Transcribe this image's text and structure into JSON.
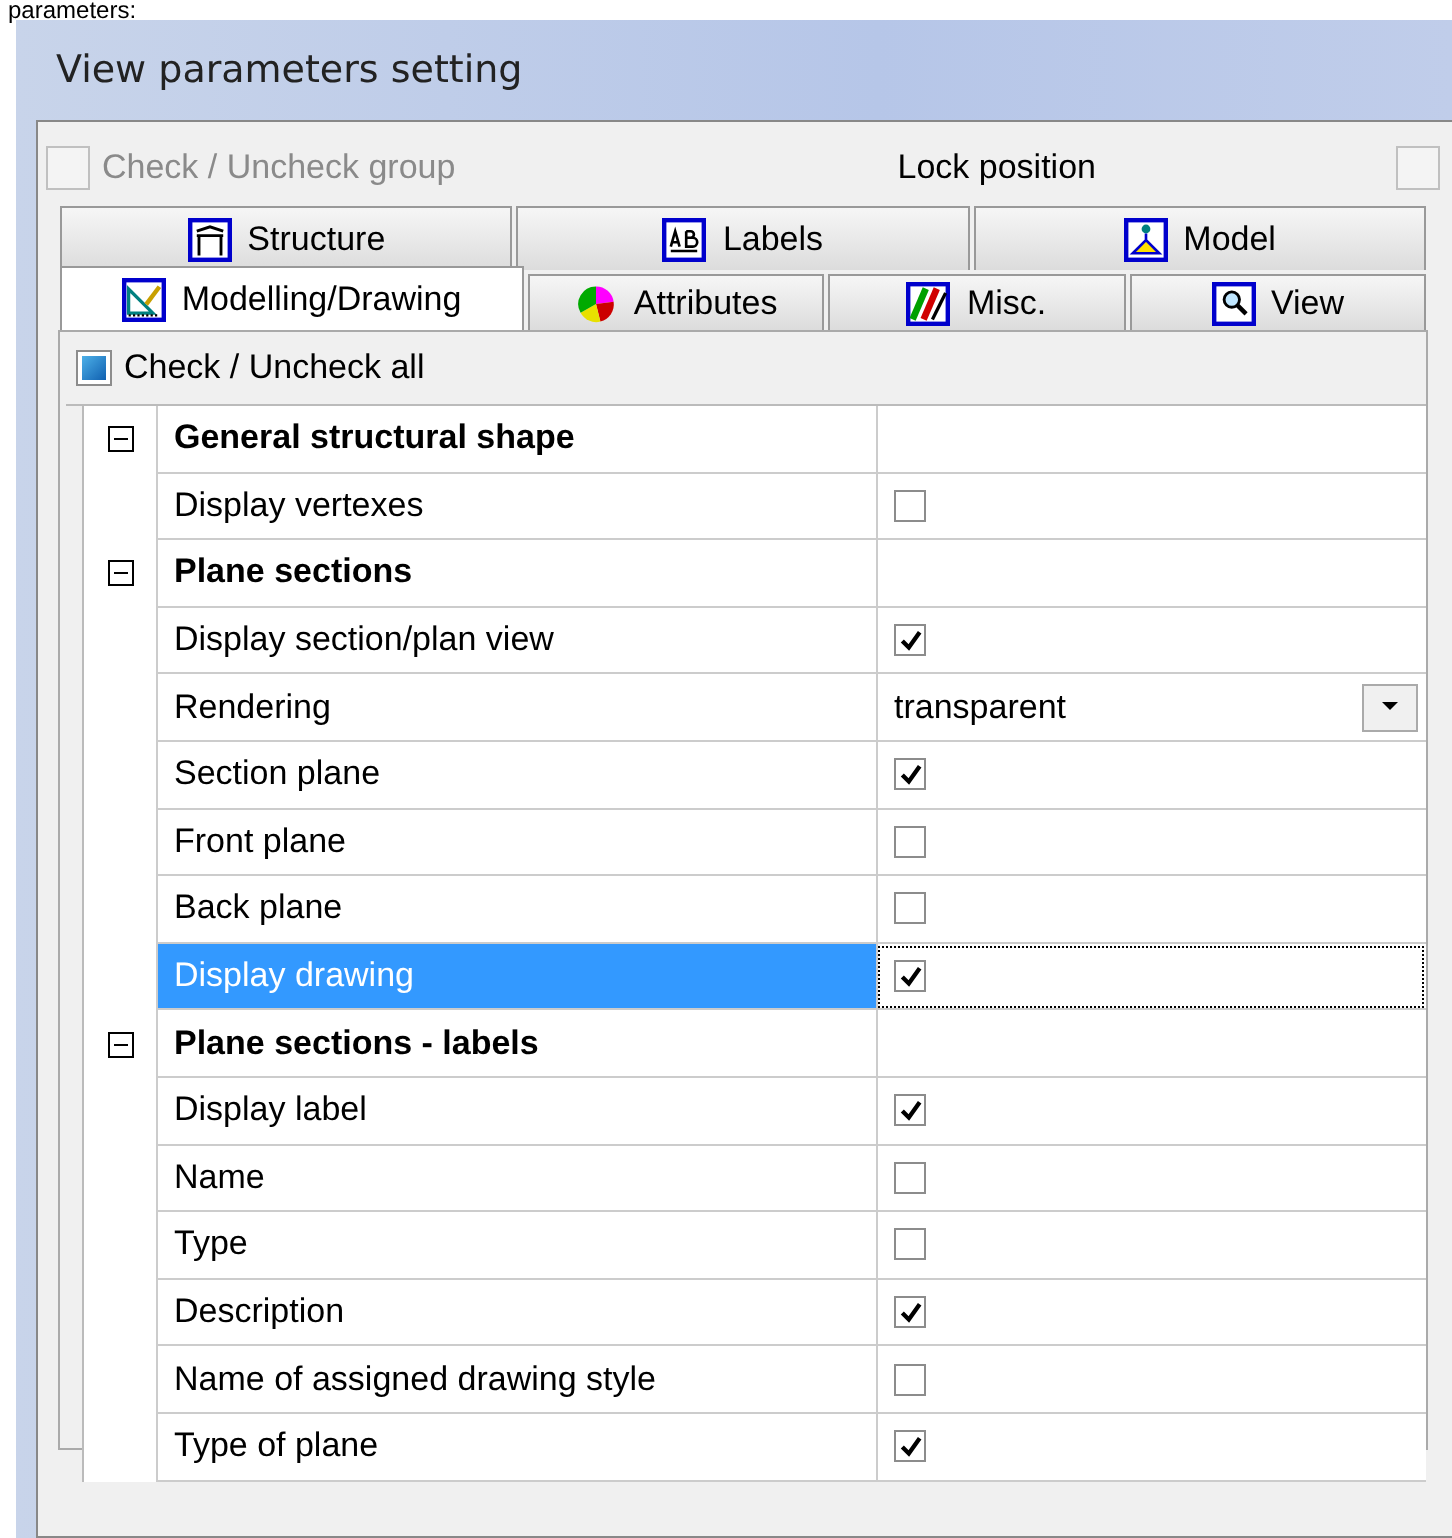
{
  "caption": "parameters:",
  "window": {
    "title": "View parameters setting"
  },
  "check_group": {
    "label": "Check / Uncheck group",
    "checked": false,
    "disabled": true
  },
  "lock_position": {
    "label": "Lock position",
    "checked": false
  },
  "tab_rows": [
    {
      "tabs": [
        {
          "label": "Structure",
          "selected": false
        },
        {
          "label": "Labels",
          "selected": false
        },
        {
          "label": "Model",
          "selected": false
        }
      ]
    },
    {
      "tabs": [
        {
          "label": "Modelling/Drawing",
          "selected": true
        },
        {
          "label": "Attributes",
          "selected": false
        },
        {
          "label": "Misc.",
          "selected": false
        },
        {
          "label": "View",
          "selected": false
        }
      ]
    }
  ],
  "check_all": {
    "label": "Check / Uncheck all",
    "indeterminate": true
  },
  "groups": [
    {
      "title": "General structural shape",
      "expanded": true,
      "rows": [
        {
          "label": "Display vertexes",
          "kind": "checkbox",
          "checked": false,
          "selected": false
        }
      ]
    },
    {
      "title": "Plane sections",
      "expanded": true,
      "rows": [
        {
          "label": "Display section/plan view",
          "kind": "checkbox",
          "checked": true,
          "selected": false
        },
        {
          "label": "Rendering",
          "kind": "dropdown",
          "value": "transparent",
          "selected": false
        },
        {
          "label": "Section plane",
          "kind": "checkbox",
          "checked": true,
          "selected": false
        },
        {
          "label": "Front plane",
          "kind": "checkbox",
          "checked": false,
          "selected": false
        },
        {
          "label": "Back plane",
          "kind": "checkbox",
          "checked": false,
          "selected": false
        },
        {
          "label": "Display drawing",
          "kind": "checkbox",
          "checked": true,
          "selected": true
        }
      ]
    },
    {
      "title": "Plane sections - labels",
      "expanded": true,
      "rows": [
        {
          "label": "Display label",
          "kind": "checkbox",
          "checked": true,
          "selected": false
        },
        {
          "label": "Name",
          "kind": "checkbox",
          "checked": false,
          "selected": false
        },
        {
          "label": "Type",
          "kind": "checkbox",
          "checked": false,
          "selected": false
        },
        {
          "label": "Description",
          "kind": "checkbox",
          "checked": true,
          "selected": false
        },
        {
          "label": "Name of assigned drawing style",
          "kind": "checkbox",
          "checked": false,
          "selected": false
        },
        {
          "label": "Type of plane",
          "kind": "checkbox",
          "checked": true,
          "selected": false
        }
      ]
    }
  ]
}
